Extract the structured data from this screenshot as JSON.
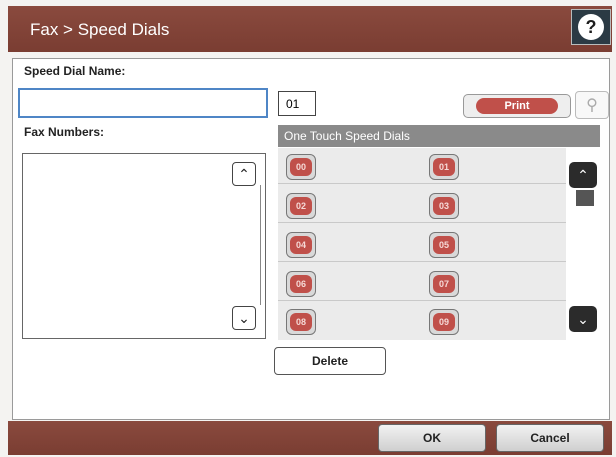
{
  "title_bar": {
    "title": "Fax > Speed Dials",
    "help_icon": "help-icon"
  },
  "form": {
    "speed_dial_name_label": "Speed Dial Name:",
    "speed_dial_name_value": "",
    "speed_dial_number": "01",
    "fax_numbers_label": "Fax Numbers:",
    "print_label": "Print",
    "search_icon": "magnifier-icon"
  },
  "one_touch": {
    "header": "One Touch Speed Dials",
    "left_column": [
      "00",
      "02",
      "04",
      "06",
      "08"
    ],
    "right_column": [
      "01",
      "03",
      "05",
      "07",
      "09"
    ]
  },
  "actions": {
    "delete_label": "Delete",
    "ok_label": "OK",
    "cancel_label": "Cancel"
  },
  "colors": {
    "title_bar": "#7a3d32",
    "accent_button": "#c0504a",
    "input_focus": "#4f86c6",
    "header_gray": "#8a8a8a"
  }
}
